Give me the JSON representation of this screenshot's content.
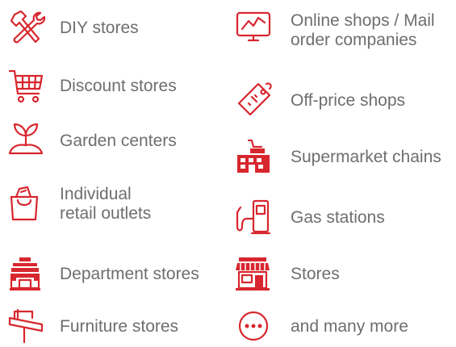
{
  "colors": {
    "accent": "#d8262e",
    "text": "#6e6e6e"
  },
  "left_column": [
    {
      "label": "DIY stores",
      "icon": "tools-icon"
    },
    {
      "label": "Discount stores",
      "icon": "shopping-cart-icon"
    },
    {
      "label": "Garden centers",
      "icon": "sprout-icon"
    },
    {
      "label_line1": "Individual",
      "label_line2": "retail outlets",
      "icon": "shopping-bag-icon"
    },
    {
      "label": "Department stores",
      "icon": "department-store-icon"
    },
    {
      "label": "Furniture stores",
      "icon": "furniture-icon"
    }
  ],
  "right_column": [
    {
      "label_line1": "Online shops / Mail",
      "label_line2": "order companies",
      "icon": "monitor-chart-icon"
    },
    {
      "label": "Off-price shops",
      "icon": "price-tag-icon"
    },
    {
      "label": "Supermarket chains",
      "icon": "supermarket-icon"
    },
    {
      "label": "Gas stations",
      "icon": "gas-pump-icon"
    },
    {
      "label": "Stores",
      "icon": "storefront-icon"
    },
    {
      "label": "and many more",
      "icon": "more-dots-icon"
    }
  ]
}
